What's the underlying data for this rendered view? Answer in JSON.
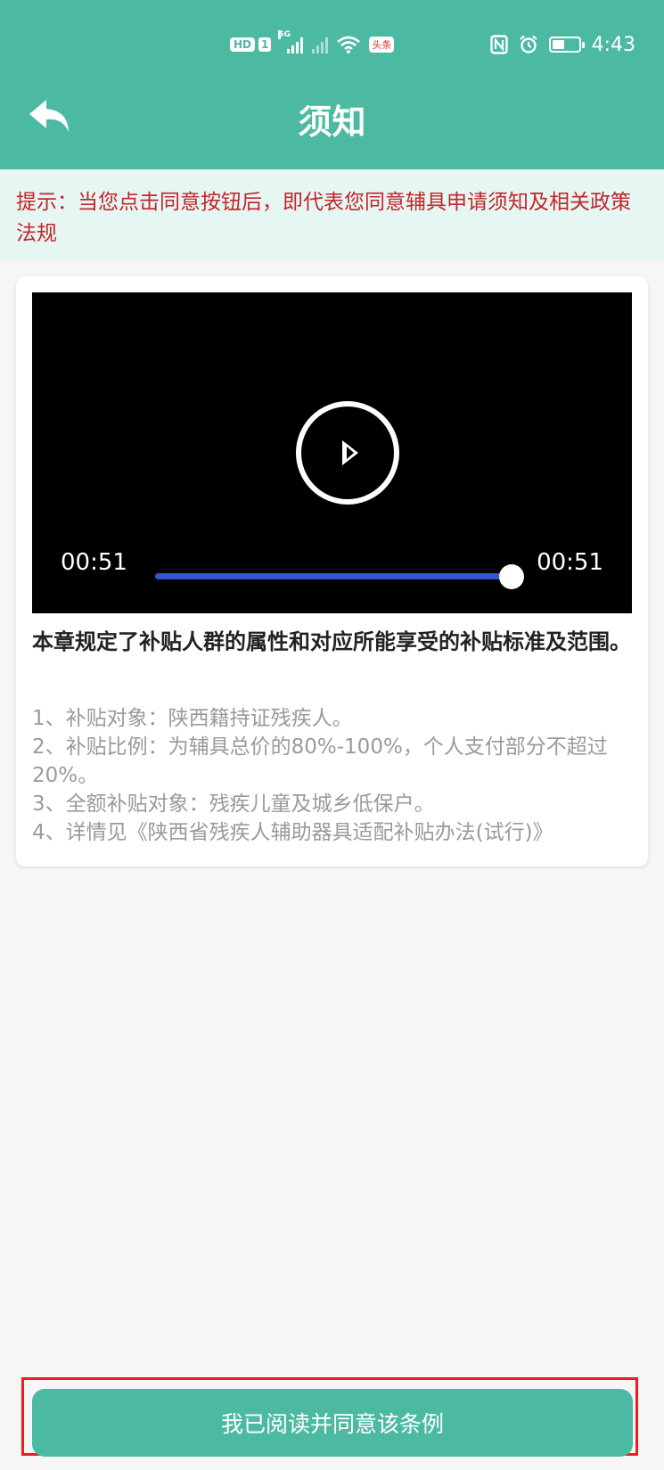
{
  "status_bar": {
    "hd_label": "HD",
    "sim_label": "1",
    "network_label": "5G",
    "news_label": "头条",
    "time": "4:43",
    "battery_percent": 46
  },
  "header": {
    "title": "须知",
    "back_icon": "back-arrow-icon"
  },
  "notice": {
    "text": "提示：当您点击同意按钮后，即代表您同意辅具申请须知及相关政策法规"
  },
  "video": {
    "current_time": "00:51",
    "duration": "00:51",
    "progress": 1.0,
    "play_icon": "play-icon"
  },
  "content": {
    "heading": "本章规定了补贴人群的属性和对应所能享受的补贴标准及范围。",
    "items": [
      "1、补贴对象：陕西籍持证残疾人。",
      "2、补贴比例：为辅具总价的80%-100%，个人支付部分不超过20%。",
      "3、全额补贴对象：残疾儿童及城乡低保户。",
      "4、详情见《陕西省残疾人辅助器具适配补贴办法(试行)》"
    ]
  },
  "footer": {
    "agree_label": "我已阅读并同意该条例"
  },
  "colors": {
    "primary": "#4cb9a3",
    "notice_bg": "#e6f6f2",
    "notice_text": "#c0272d",
    "progress": "#3056d3",
    "highlight": "#ee1c1c"
  }
}
